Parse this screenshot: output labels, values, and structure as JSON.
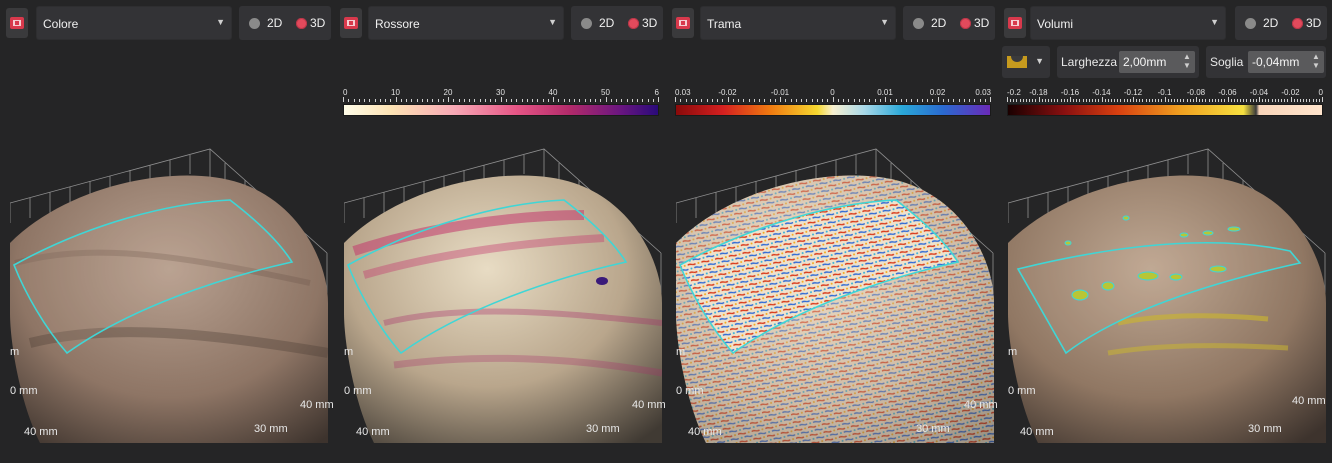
{
  "panels": [
    {
      "id": "colore",
      "dropdown_label": "Colore",
      "mode_2d": "2D",
      "mode_3d": "3D",
      "scale": null,
      "axis": {
        "z": "m",
        "y": "0 mm",
        "y2": "40 mm",
        "x": "30 mm",
        "x2": "40 mm"
      }
    },
    {
      "id": "rossore",
      "dropdown_label": "Rossore",
      "mode_2d": "2D",
      "mode_3d": "3D",
      "scale": {
        "ticks": [
          "0",
          "10",
          "20",
          "30",
          "40",
          "50",
          "6"
        ]
      },
      "axis": {
        "z": "m",
        "y": "0 mm",
        "y2": "40 mm",
        "x": "30 mm",
        "x2": "40 mm"
      }
    },
    {
      "id": "trama",
      "dropdown_label": "Trama",
      "mode_2d": "2D",
      "mode_3d": "3D",
      "scale": {
        "ticks": [
          "0.03",
          "-0.02",
          "-0.01",
          "0",
          "0.01",
          "0.02",
          "0.03"
        ]
      },
      "axis": {
        "z": "m",
        "y": "0 mm",
        "y2": "40 mm",
        "x": "30 mm",
        "x2": "40 mm"
      }
    },
    {
      "id": "volumi",
      "dropdown_label": "Volumi",
      "mode_2d": "2D",
      "mode_3d": "3D",
      "scale": {
        "ticks": [
          "-0.2",
          "-0.18",
          "-0.16",
          "-0.14",
          "-0.12",
          "-0.1",
          "-0.08",
          "-0.06",
          "-0.04",
          "-0.02",
          "0"
        ]
      },
      "axis": {
        "z": "m",
        "y": "0 mm",
        "y2": "40 mm",
        "x": "30 mm",
        "x2": "40 mm"
      }
    }
  ],
  "volumi_tools": {
    "larghezza_label": "Larghezza",
    "larghezza_value": "2,00mm",
    "soglia_label": "Soglia",
    "soglia_value": "-0,04mm"
  },
  "colors": {
    "background": "#252526",
    "control": "#333336",
    "selection_outline": "#3fd6d6",
    "radio_active": "#e24a5c",
    "capture_icon": "#d8394c"
  }
}
